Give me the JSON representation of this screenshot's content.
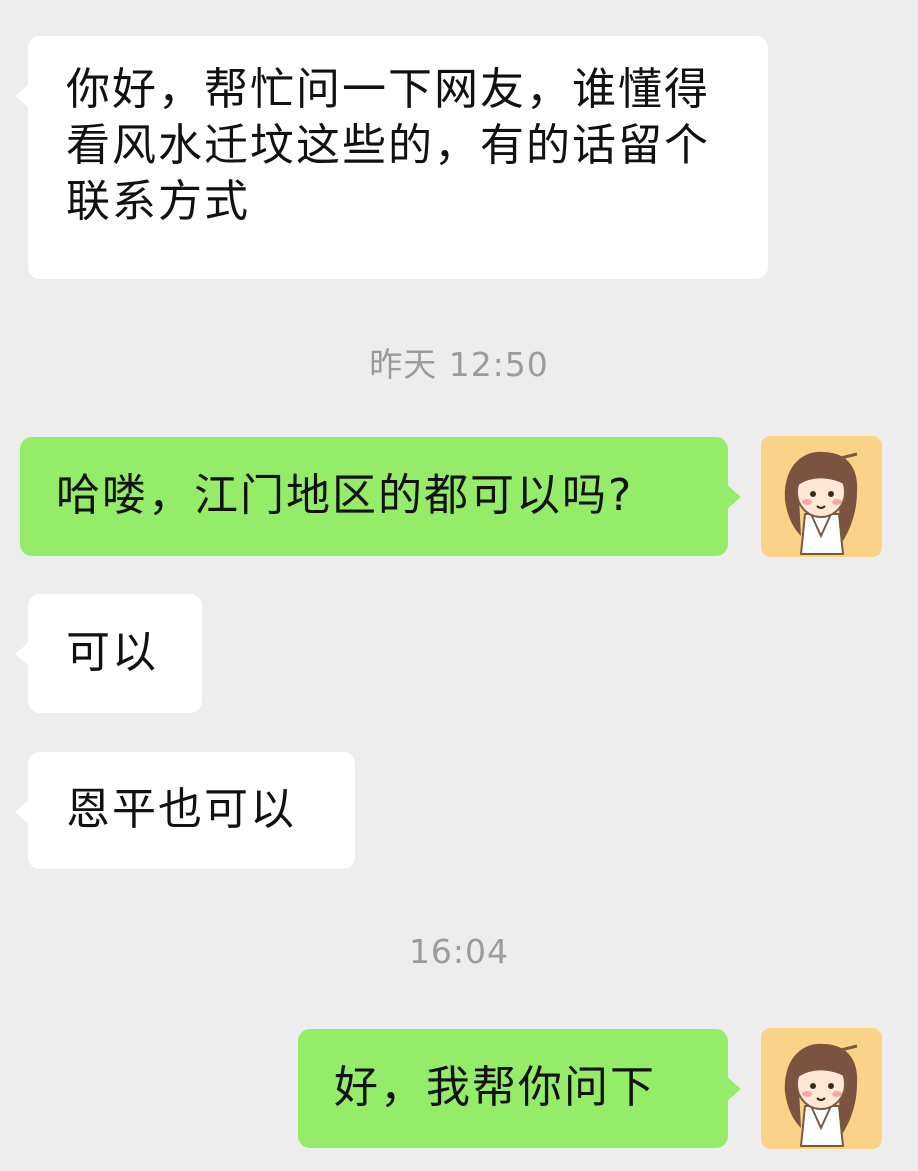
{
  "chat": {
    "messages": [
      {
        "direction": "incoming",
        "text": "你好，帮忙问一下网友，谁懂得看风水迁坟这些的，有的话留个联系方式"
      },
      {
        "direction": "outgoing",
        "text": "哈喽，江门地区的都可以吗?"
      },
      {
        "direction": "incoming",
        "text": "可以"
      },
      {
        "direction": "incoming",
        "text": "恩平也可以"
      },
      {
        "direction": "outgoing",
        "text": "好，我帮你问下"
      }
    ],
    "timestamps": [
      "昨天 12:50",
      "16:04"
    ]
  },
  "colors": {
    "background": "#ededed",
    "incoming_bubble": "#ffffff",
    "outgoing_bubble": "#95ec69",
    "timestamp_text": "#9b9b9b",
    "avatar_background": "#fbd388"
  },
  "icons": {
    "avatar": "cartoon-character-avatar-icon"
  }
}
